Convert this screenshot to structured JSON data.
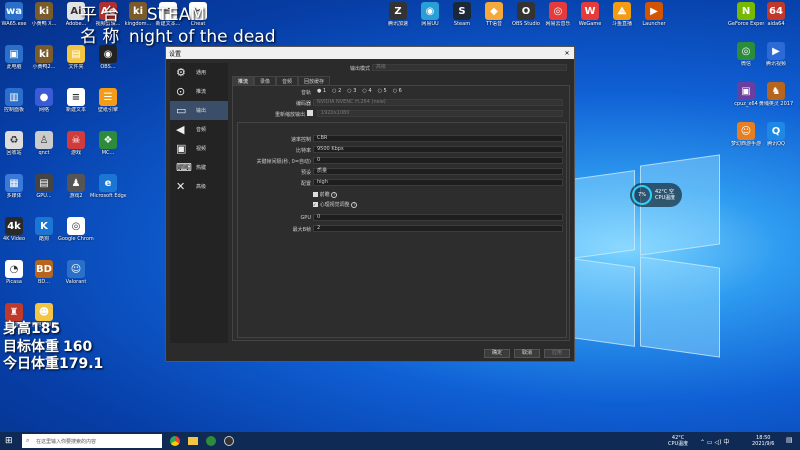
{
  "overlay": {
    "line1_a": "平  台",
    "line1_b": "STEAM",
    "line2_a": "名  称",
    "line2_b": "night of the dead",
    "h_label": "身高",
    "h_val": "185",
    "t_label": "目标体重",
    "t_val": "160",
    "c_label": "今日体重",
    "c_val": "179.1"
  },
  "desktop_left": [
    [
      "#2a6fc9",
      "wa",
      "WA65.exe"
    ],
    [
      "#7a5b2c",
      "ki",
      "小黄鸭 X..."
    ],
    [
      "#e3e3e3",
      "Ai",
      "Adobe..."
    ],
    [
      "#b03030",
      "Ae",
      "视频剪辑..."
    ],
    [
      "#7a5b2c",
      "ki",
      "kingdom..."
    ],
    [
      "#ffffff",
      "≡",
      "新建文本..."
    ],
    [
      "#ffffff",
      "✂",
      "Cheat"
    ],
    [
      "#2a6fc9",
      "▣",
      "此电脑"
    ],
    [
      "#7a5b2c",
      "ki",
      "小黄鸭2..."
    ],
    [
      "#f4c542",
      "▤",
      "文件夹"
    ],
    [
      "#222",
      "◉",
      "OBS..."
    ],
    [
      "#2a6fc9",
      "▥",
      "控制面板"
    ],
    [
      "#3b5ad6",
      "●",
      "网络"
    ],
    [
      "#ffffff",
      "≡",
      "新建文本"
    ],
    [
      "#f49b1a",
      "☰",
      "壁纸引擎"
    ],
    [
      "#dddddd",
      "♻",
      "回收站"
    ],
    [
      "#cccccc",
      "♙",
      "qnct"
    ],
    [
      "#d23b3b",
      "☠",
      "游戏"
    ],
    [
      "#2c8c3c",
      "❖",
      "MC..."
    ],
    [
      "#3a7ad6",
      "▦",
      "多媒体"
    ],
    [
      "#444",
      "▤",
      "GPU..."
    ],
    [
      "#555",
      "♟",
      "游戏2"
    ],
    [
      "#1a76d2",
      "e",
      "Microsoft Edge"
    ],
    [
      "#2a2a2a",
      "4k",
      "4K Video"
    ],
    [
      "#1a76d2",
      "K",
      "酷狗"
    ],
    [
      "#ffffff",
      "◎",
      "Google Chrome"
    ],
    [
      "#ffffff",
      "◔",
      "Picasa"
    ],
    [
      "#b5651d",
      "BD",
      "BD..."
    ],
    [
      "#2a6fc9",
      "☺",
      "Valorant"
    ],
    [
      "#c0392b",
      "♜",
      "二手游戏"
    ],
    [
      "#f4c542",
      "☻",
      "雷电模拟器"
    ]
  ],
  "desktop_top": [
    [
      "#333",
      "Z",
      "腾讯加速"
    ],
    [
      "#2a9fd6",
      "◉",
      "网易UU"
    ],
    [
      "#1b2838",
      "S",
      "Steam"
    ],
    [
      "#f3a93b",
      "◆",
      "TT语音"
    ],
    [
      "#333",
      "O",
      "OBS Studio"
    ],
    [
      "#e43b3b",
      "◎",
      "网易云音乐"
    ],
    [
      "#e43b3b",
      "W",
      "WeGame"
    ],
    [
      "#f39c12",
      "⟁",
      "斗鱼直播"
    ],
    [
      "#d35400",
      "▶",
      "Launcher"
    ]
  ],
  "desktop_right": [
    [
      "#76b900",
      "N",
      "GeForce Experience"
    ],
    [
      "#c0392b",
      "64",
      "aida64"
    ],
    [
      "#2c8c3c",
      "◎",
      "微信"
    ],
    [
      "#2d6ad6",
      "▶",
      "腾讯视频"
    ],
    [
      "#6b3fa0",
      "▣",
      "cpuz_x64"
    ],
    [
      "#b5651d",
      "♞",
      "黄埔英灵 2017"
    ],
    [
      "#e67e22",
      "☺",
      "梦幻西游手游"
    ],
    [
      "#1e88e5",
      "Q",
      "腾讯QQ"
    ]
  ],
  "dialog": {
    "title": "设置",
    "sidebar": [
      "通用",
      "推流",
      "输出",
      "音频",
      "视频",
      "热键",
      "高级"
    ],
    "tabs": [
      "推流",
      "录像",
      "音频",
      "回放缓存"
    ],
    "output_mode_label": "输出模式",
    "output_mode_value": "高级",
    "track_label": "音轨",
    "track_values": [
      "1",
      "2",
      "3",
      "4",
      "5",
      "6"
    ],
    "encoder_label": "编码器",
    "encoder_value": "NVIDIA NVENC H.264 (new)",
    "rescale_label": "重新缩放输出",
    "rescale_value": "1920x1080",
    "rate_label": "速率控制",
    "rate_value": "CBR",
    "bitrate_label": "比特率",
    "bitrate_value": "9500 Kbps",
    "keyint_label": "关键帧间隔(秒, 0=自动)",
    "keyint_value": "0",
    "preset_label": "预设",
    "preset_value": "质量",
    "profile_label": "配置",
    "profile_value": "high",
    "lookahead_label": "前瞻",
    "psycho_label": "心理视觉调整",
    "gpu_label": "GPU",
    "gpu_value": "0",
    "bframes_label": "最大B帧",
    "bframes_value": "2",
    "ok": "确定",
    "cancel": "取消",
    "apply": "应用"
  },
  "widget": {
    "pct": "7%",
    "temp": "42°C 空",
    "label": "CPU温度"
  },
  "taskbar": {
    "search": "在这里输入你要搜索的内容",
    "temp": "42°C",
    "temp_label": "CPU温度",
    "time": "18:50",
    "date": "2021/9/6"
  }
}
